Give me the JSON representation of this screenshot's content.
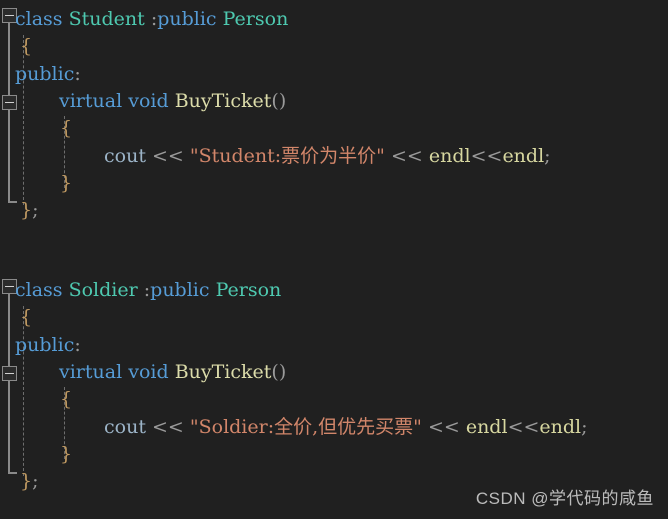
{
  "editor": {
    "title": "code-editor",
    "background_color": "#202020",
    "theme": "visual-studio-dark",
    "language": "cpp"
  },
  "colors": {
    "background": "#202020",
    "keyword": "#569cd6",
    "type": "#4ec9b0",
    "function": "#dcdcaa",
    "identifier": "#9cb4c8",
    "string": "#d2866a",
    "macro": "#d7d7a0",
    "punctuation": "#9a9a9a",
    "brace": "#c09a62",
    "outline_margin": "#8a8a8a",
    "indent_guide": "#6e6e6e",
    "watermark": "#c9c9c9"
  },
  "code": {
    "block_student": {
      "line_class": {
        "kw_class": "class",
        "space1": " ",
        "type_name": "Student",
        "space2": " ",
        "colon": ":",
        "kw_public": "public",
        "space3": " ",
        "base_type": "Person"
      },
      "line_open_brace": "{",
      "line_access": {
        "kw_public": "public",
        "colon": ":"
      },
      "line_method": {
        "kw_virtual": "virtual",
        "space1": " ",
        "kw_void": "void",
        "space2": " ",
        "fn_name": "BuyTicket",
        "parens": "()"
      },
      "line_method_open": "{",
      "line_body": {
        "ident_cout": "cout",
        "op1": " << ",
        "string_literal": "\"Student:票价为半价\"",
        "op2": " << ",
        "macro1": "endl",
        "op3": "<<",
        "macro2": "endl",
        "semicolon": ";"
      },
      "line_method_close": "}",
      "line_class_close": {
        "brace": "}",
        "semicolon": ";"
      }
    },
    "block_soldier": {
      "line_class": {
        "kw_class": "class",
        "space1": " ",
        "type_name": "Soldier",
        "space2": " ",
        "colon": ":",
        "kw_public": "public",
        "space3": " ",
        "base_type": "Person"
      },
      "line_open_brace": "{",
      "line_access": {
        "kw_public": "public",
        "colon": ":"
      },
      "line_method": {
        "kw_virtual": "virtual",
        "space1": " ",
        "kw_void": "void",
        "space2": " ",
        "fn_name": "BuyTicket",
        "parens": "()"
      },
      "line_method_open": "{",
      "line_body": {
        "ident_cout": "cout",
        "op1": " << ",
        "string_literal": "\"Soldier:全价,但优先买票\"",
        "op2": " << ",
        "macro1": "endl",
        "op3": "<<",
        "macro2": "endl",
        "semicolon": ";"
      },
      "line_method_close": "}",
      "line_class_close": {
        "brace": "}",
        "semicolon": ";"
      }
    }
  },
  "watermark": {
    "text": "CSDN @学代码的咸鱼"
  }
}
